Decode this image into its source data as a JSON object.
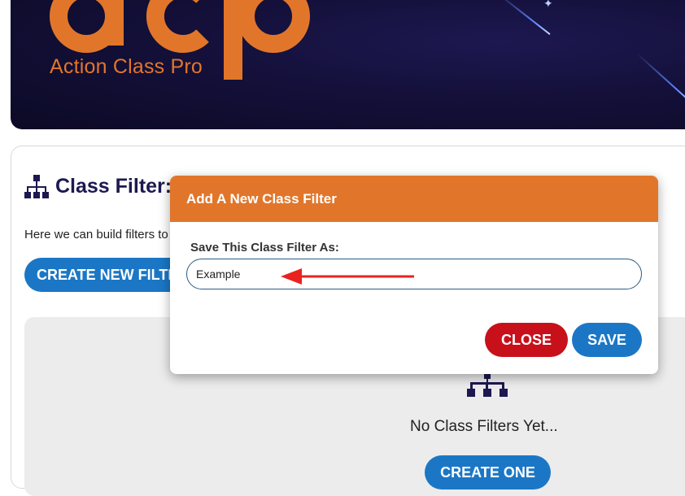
{
  "header": {
    "logo_mark": "acp",
    "brand_name": "Action Class Pro",
    "accent_color": "#e1762b",
    "background_color": "#14103a"
  },
  "page": {
    "section_title": "Class Filter:",
    "section_icon": "sitemap-icon",
    "description": "Here we can build filters to",
    "create_new_label": "CREATE NEW FILTER",
    "empty_state": {
      "icon": "sitemap-icon",
      "message": "No Class Filters Yet...",
      "create_one_label": "CREATE ONE"
    }
  },
  "modal": {
    "title": "Add A New Class Filter",
    "field_label": "Save This Class Filter As:",
    "field_value": "Example",
    "close_label": "CLOSE",
    "save_label": "SAVE",
    "annotation": "red-arrow-icon"
  },
  "colors": {
    "primary_button": "#1b77c5",
    "danger_button": "#c8101b",
    "title_color": "#1d1850"
  }
}
